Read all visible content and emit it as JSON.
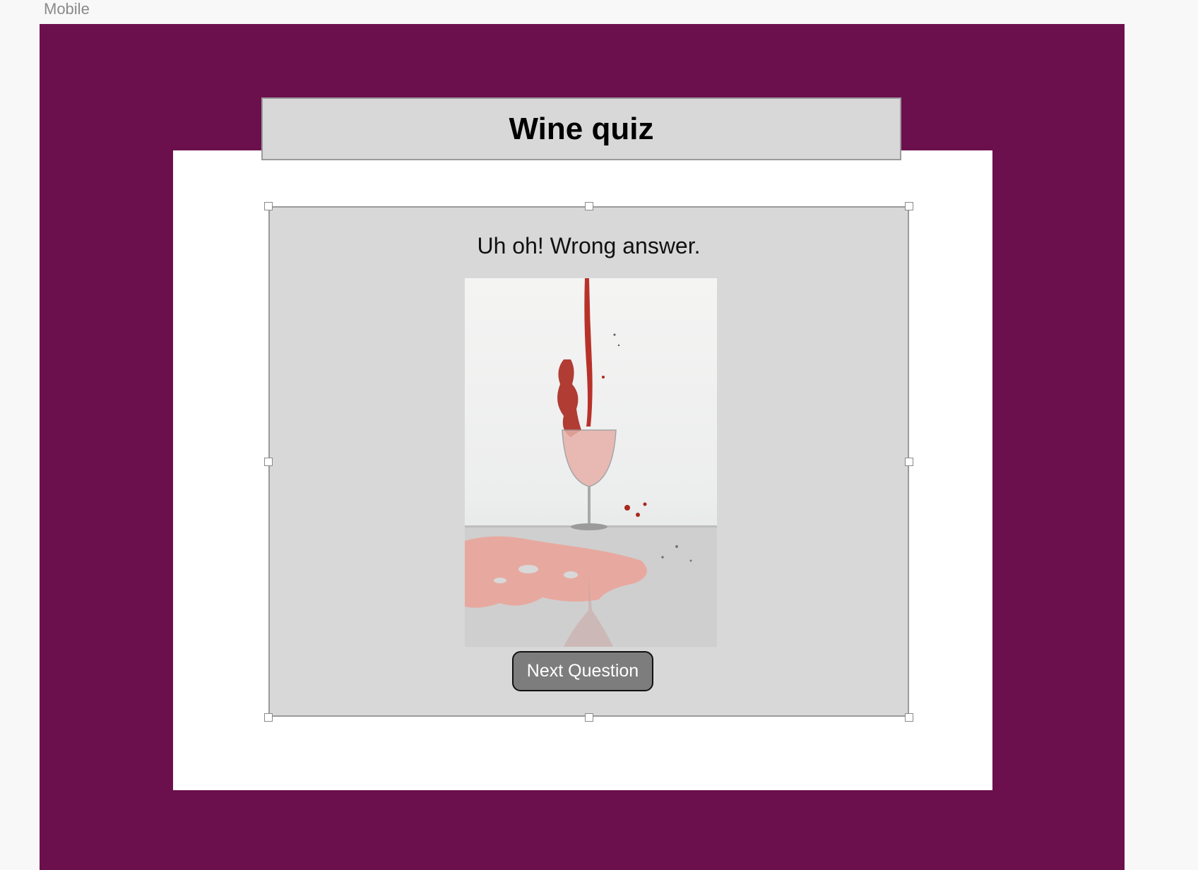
{
  "artboard": {
    "label": "Mobile",
    "background": "#6b104d"
  },
  "header": {
    "title": "Wine quiz"
  },
  "quiz": {
    "message": "Uh oh! Wrong answer.",
    "image_subject": "red wine splashing into glass",
    "next_button_label": "Next Question"
  },
  "colors": {
    "panel_gray": "#d8d8d8",
    "button_gray": "#7d7d7d",
    "wine_red": "#b8322a"
  }
}
